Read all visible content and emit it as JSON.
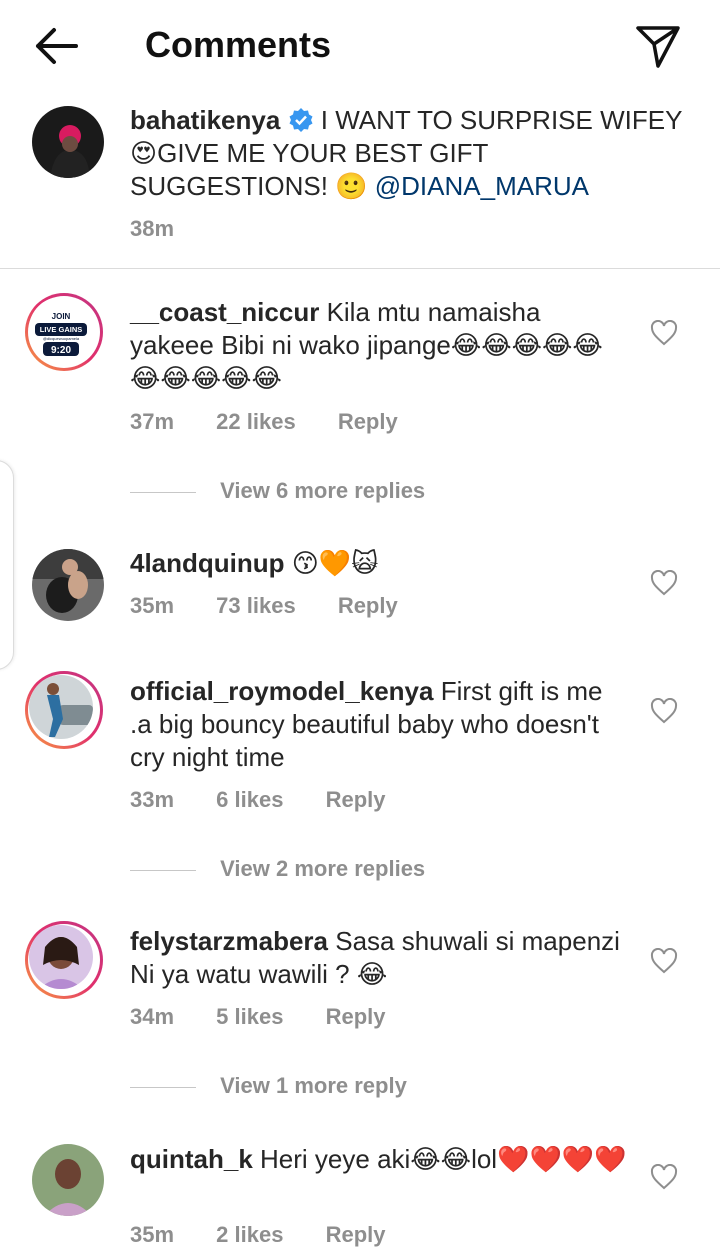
{
  "header": {
    "title": "Comments"
  },
  "caption": {
    "username": "bahatikenya",
    "text": "I WANT TO SURPRISE WIFEY 😍GIVE ME YOUR BEST GIFT SUGGESTIONS! 🙂",
    "mention": "@DIANA_MARUA",
    "time": "38m"
  },
  "comments": [
    {
      "username": "__coast_niccur",
      "text": "Kila mtu namaisha yakeee Bibi ni wako jipange😂😂😂😂😂😂😂😂😂😂",
      "time": "37m",
      "likes": "22 likes",
      "reply": "Reply",
      "view_more": "View 6 more replies",
      "avatar_text": {
        "l1": "JOIN",
        "l2": "LIVE GAINS",
        "l3": "@dicquewuopamela",
        "l4": "9:20"
      }
    },
    {
      "username": "4landquinup",
      "text": "😙🧡🙀",
      "time": "35m",
      "likes": "73 likes",
      "reply": "Reply"
    },
    {
      "username": "official_roymodel_kenya",
      "text": "First gift is me .a big bouncy beautiful baby who doesn't cry night time",
      "time": "33m",
      "likes": "6 likes",
      "reply": "Reply",
      "view_more": "View 2 more replies"
    },
    {
      "username": "felystarzmabera",
      "text": "Sasa shuwali si mapenzi Ni ya watu wawili ? 😂",
      "time": "34m",
      "likes": "5 likes",
      "reply": "Reply",
      "view_more": "View 1 more reply"
    },
    {
      "username": "quintah_k",
      "text": "Heri yeye aki😂😂lol❤️❤️❤️❤️",
      "time": "35m",
      "likes": "2 likes",
      "reply": "Reply"
    }
  ],
  "colors": {
    "link": "#00376b",
    "muted": "#8e8e8e",
    "verified": "#3897f0"
  },
  "icons": [
    "back-arrow-icon",
    "send-icon",
    "verified-badge-icon",
    "heart-icon"
  ]
}
